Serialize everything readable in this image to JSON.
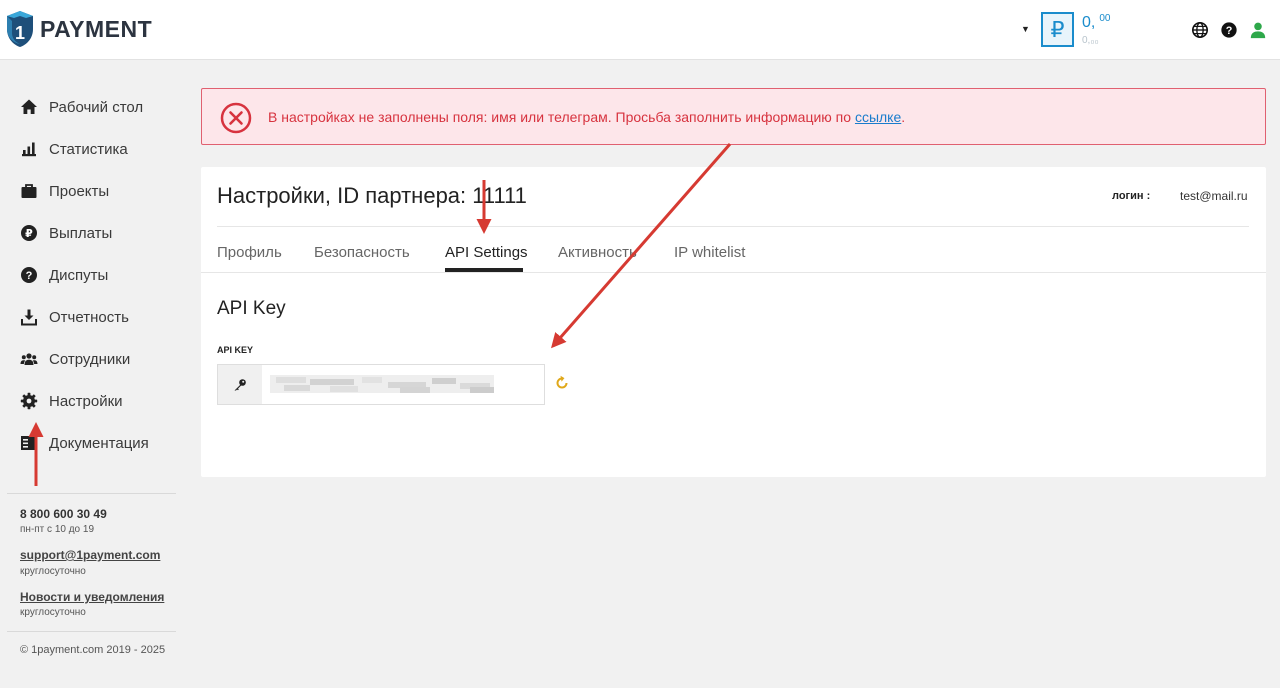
{
  "header": {
    "brand": "PAYMENT",
    "currency_symbol": "₽",
    "balance_main": "0,",
    "balance_main_cents": "00",
    "balance_sub": "0,₀₀"
  },
  "sidebar": {
    "items": [
      {
        "label": "Рабочий стол",
        "icon": "home-icon"
      },
      {
        "label": "Статистика",
        "icon": "bar-chart-icon"
      },
      {
        "label": "Проекты",
        "icon": "briefcase-icon"
      },
      {
        "label": "Выплаты",
        "icon": "ruble-circle-icon"
      },
      {
        "label": "Диспуты",
        "icon": "question-circle-icon"
      },
      {
        "label": "Отчетность",
        "icon": "download-icon"
      },
      {
        "label": "Сотрудники",
        "icon": "users-icon"
      },
      {
        "label": "Настройки",
        "icon": "gear-icon"
      },
      {
        "label": "Документация",
        "icon": "document-icon"
      }
    ],
    "phone": "8 800 600 30 49",
    "phone_hours": "пн-пт с 10 до 19",
    "support_email": "support@1payment.com",
    "support_hours": "круглосуточно",
    "news_link": "Новости и уведомления",
    "news_hours": "круглосуточно",
    "copyright": "© 1payment.com 2019 - 2025"
  },
  "alert": {
    "text": "В настройках не заполнены поля: имя или телеграм. Просьба заполнить информацию по ",
    "link": "ссылке",
    "suffix": "."
  },
  "card": {
    "title": "Настройки, ID партнера: 11111",
    "login_label": "логин :",
    "login_value": "test@mail.ru",
    "tabs": [
      "Профиль",
      "Безопасность",
      "API Settings",
      "Активность",
      "IP whitelist"
    ],
    "active_tab": "API Settings",
    "section_title": "API Key",
    "field_label": "API KEY"
  },
  "colors": {
    "accent": "#1a8ccc",
    "alert_text": "#d7333f",
    "alert_bg": "#fde6ea",
    "arrow": "#d63a32",
    "refresh": "#e0a81a",
    "user_icon": "#2ea84a"
  }
}
